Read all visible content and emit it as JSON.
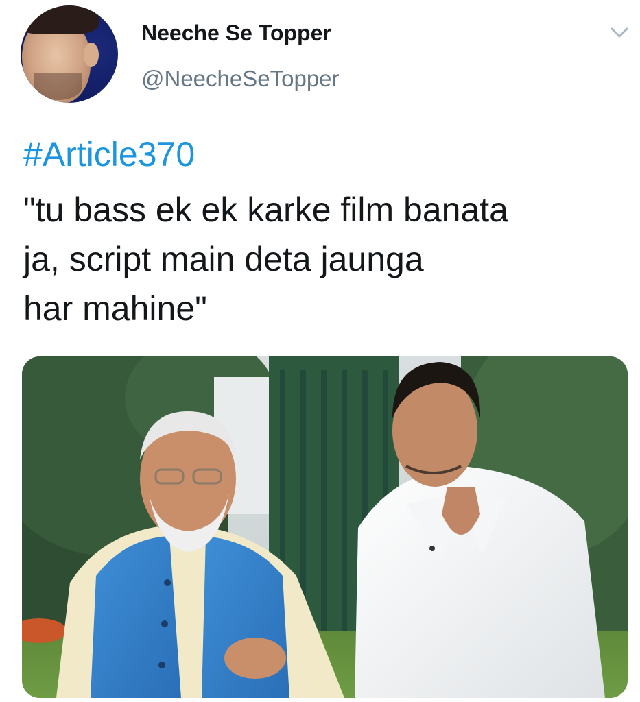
{
  "tweet": {
    "author": {
      "display_name": "Neeche Se Topper",
      "handle": "@NeecheSeTopper",
      "avatar_icon": "profile-avatar"
    },
    "menu_icon": "chevron-down-icon",
    "hashtag": "#Article370",
    "text": "\"tu bass ek ek karke film banata\nja, script main deta jaunga\nhar mahine\"",
    "media": {
      "type": "photo",
      "icon": "photo-of-two-men-in-garden"
    }
  },
  "colors": {
    "background": "#ffffff",
    "text": "#14171a",
    "handle": "#657786",
    "hashtag": "#1b95e0"
  }
}
